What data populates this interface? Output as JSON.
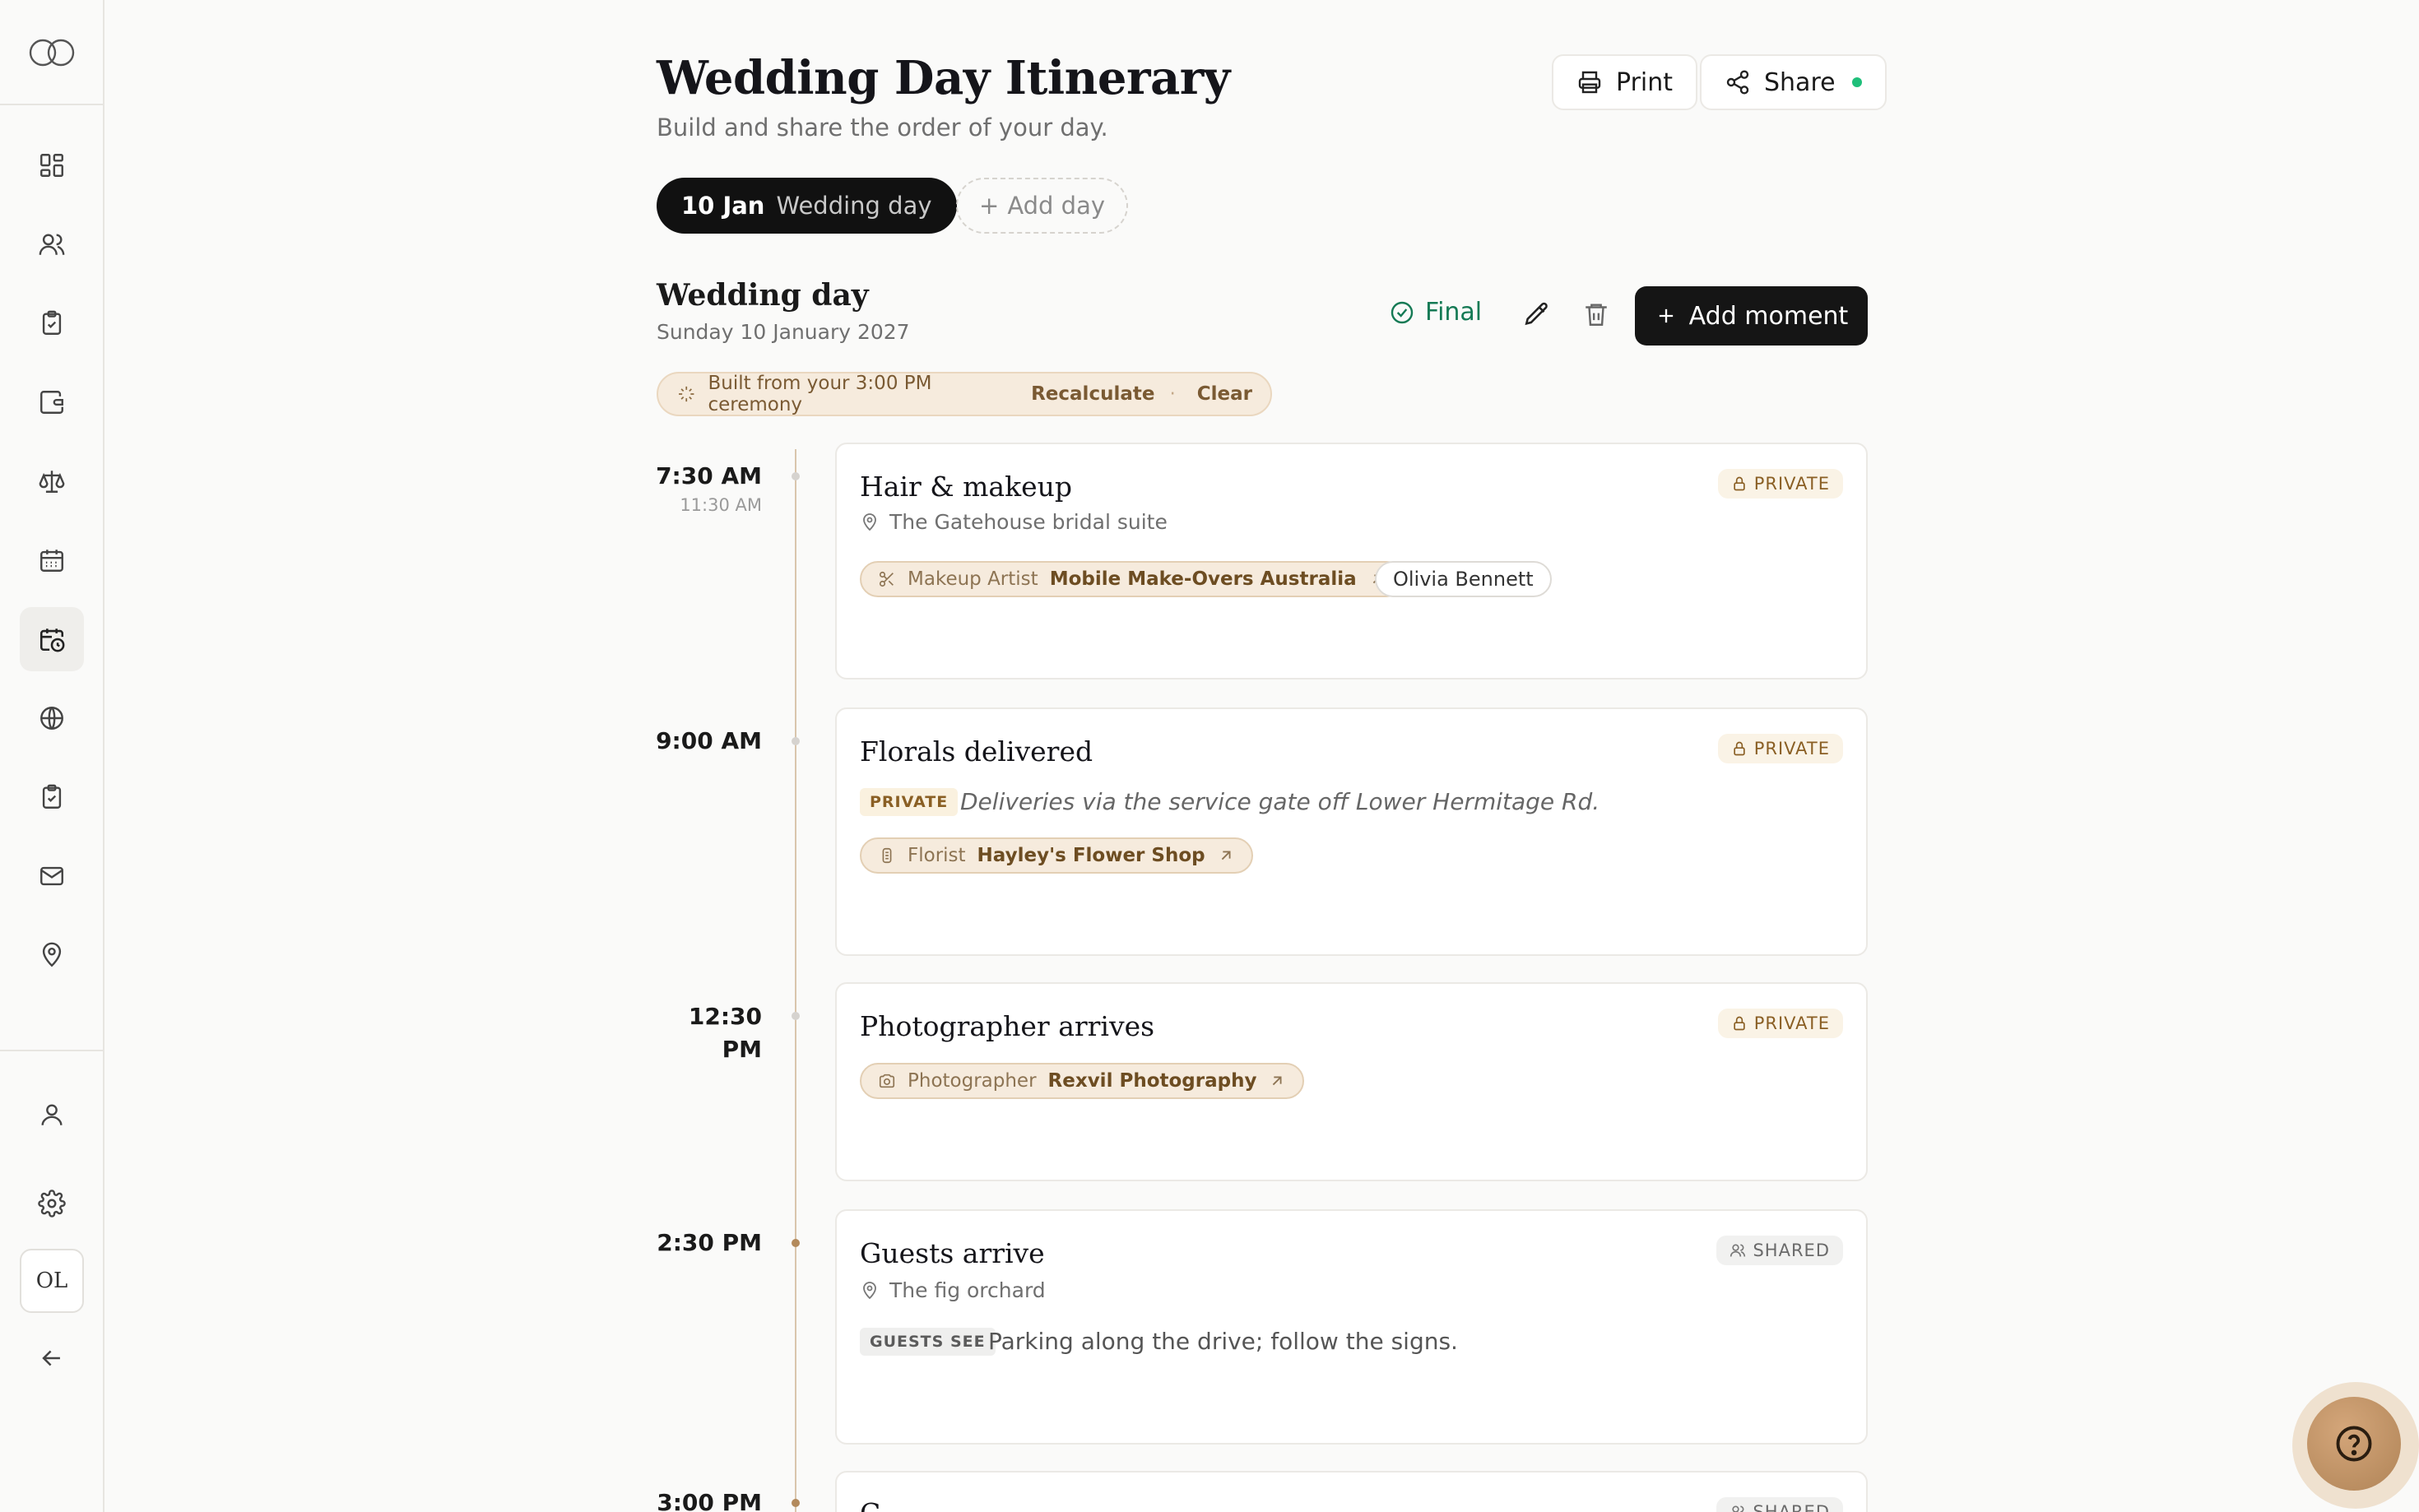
{
  "header": {
    "title": "Wedding Day Itinerary",
    "subtitle": "Build and share the order of your day.",
    "print_label": "Print",
    "share_label": "Share"
  },
  "days": {
    "active_date": "10 Jan",
    "active_name": "Wedding day",
    "add_label": "Add day"
  },
  "day": {
    "name": "Wedding day",
    "date": "Sunday 10 January 2027",
    "status": "Final",
    "add_moment_label": "Add moment"
  },
  "built": {
    "text": "Built from your 3:00 PM ceremony",
    "recalculate": "Recalculate",
    "separator": "·",
    "clear": "Clear"
  },
  "sidebar": {
    "avatar_initials": "OL",
    "icons": [
      "dashboard-icon",
      "guests-icon",
      "checklist-icon",
      "budget-icon",
      "scales-icon",
      "calendar-icon",
      "itinerary-icon",
      "website-icon",
      "tasks-icon",
      "mail-icon",
      "location-icon",
      "profile-icon",
      "settings-icon",
      "back-icon"
    ]
  },
  "moments": [
    {
      "time": "7:30 AM",
      "end_time": "11:30 AM",
      "title": "Hair & makeup",
      "visibility": "PRIVATE",
      "location": "The Gatehouse bridal suite",
      "vendor_role": "Makeup Artist",
      "vendor_name": "Mobile Make-Overs Australia",
      "person": "Olivia Bennett"
    },
    {
      "time": "9:00 AM",
      "title": "Florals delivered",
      "visibility": "PRIVATE",
      "note_tag": "PRIVATE",
      "note": "Deliveries via the service gate off Lower Hermitage Rd.",
      "vendor_role": "Florist",
      "vendor_name": "Hayley's Flower Shop"
    },
    {
      "time_line1": "12:30",
      "time_line2": "PM",
      "title": "Photographer arrives",
      "visibility": "PRIVATE",
      "vendor_role": "Photographer",
      "vendor_name": "Rexvil Photography"
    },
    {
      "time": "2:30 PM",
      "title": "Guests arrive",
      "visibility": "SHARED",
      "location": "The fig orchard",
      "note_tag": "GUESTS SEE",
      "note": "Parking along the drive; follow the signs."
    },
    {
      "time": "3:00 PM",
      "title": "C",
      "visibility": "SHARED"
    }
  ]
}
